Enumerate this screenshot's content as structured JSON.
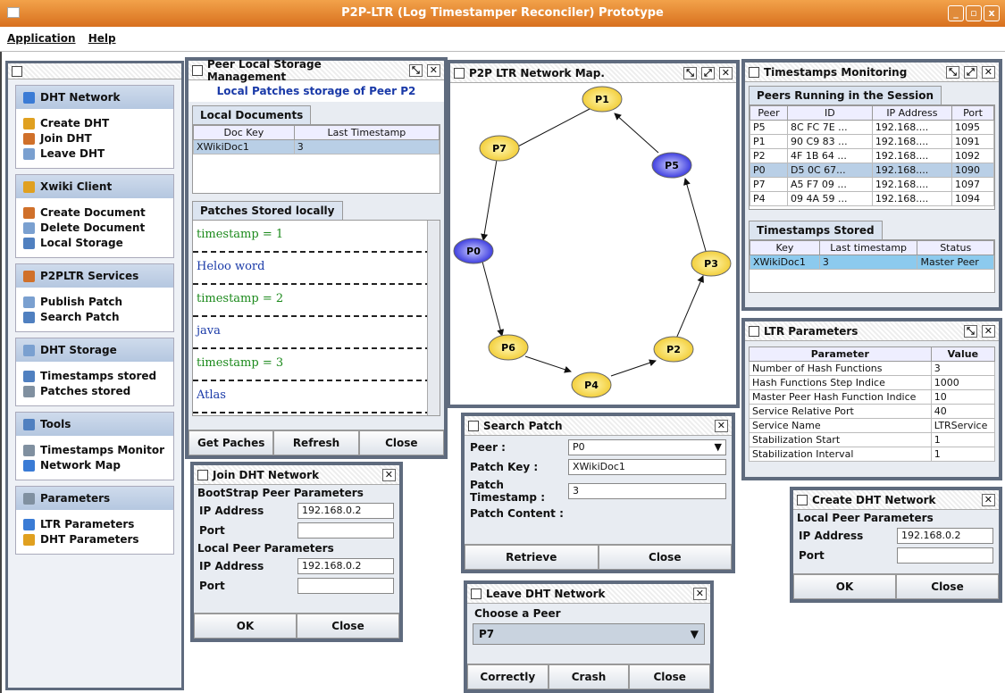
{
  "window": {
    "title": "P2P-LTR (Log Timestamper Reconciler) Prototype"
  },
  "menu": [
    "Application",
    "Help"
  ],
  "sidebar": {
    "sections": [
      {
        "title": "DHT Network",
        "items": [
          "Create DHT",
          "Join DHT",
          "Leave DHT"
        ]
      },
      {
        "title": "Xwiki Client",
        "items": [
          "Create Document",
          "Delete Document",
          "Local Storage"
        ]
      },
      {
        "title": "P2PLTR Services",
        "items": [
          "Publish Patch",
          "Search Patch"
        ]
      },
      {
        "title": "DHT Storage",
        "items": [
          "Timestamps stored",
          "Patches stored"
        ]
      },
      {
        "title": "Tools",
        "items": [
          "Timestamps Monitor",
          "Network Map"
        ]
      },
      {
        "title": "Parameters",
        "items": [
          "LTR Parameters",
          "DHT Parameters"
        ]
      }
    ]
  },
  "storage": {
    "title": "Peer Local Storage Management",
    "subtitle": "Local Patches storage of Peer P2",
    "tab1": "Local Documents",
    "cols": [
      "Doc Key",
      "Last Timestamp"
    ],
    "rows": [
      [
        "XWikiDoc1",
        "3"
      ]
    ],
    "tab2": "Patches Stored locally",
    "patches": [
      "timestamp = 1",
      "Heloo word",
      "timestamp = 2",
      "java",
      "timestamp = 3",
      "Atlas"
    ],
    "buttons": [
      "Get Paches",
      "Refresh",
      "Close"
    ]
  },
  "map": {
    "title": "P2P LTR Network Map.",
    "nodes": [
      "P1",
      "P5",
      "P3",
      "P2",
      "P4",
      "P6",
      "P0",
      "P7"
    ]
  },
  "monitor": {
    "title": "Timestamps Monitoring",
    "tab1": "Peers Running in the Session",
    "cols": [
      "Peer",
      "ID",
      "IP Address",
      "Port"
    ],
    "rows": [
      [
        "P5",
        "8C FC 7E ...",
        "192.168....",
        "1095"
      ],
      [
        "P1",
        "90 C9 83 ...",
        "192.168....",
        "1091"
      ],
      [
        "P2",
        "4F 1B 64 ...",
        "192.168....",
        "1092"
      ],
      [
        "P0",
        "D5 0C 67...",
        "192.168....",
        "1090"
      ],
      [
        "P7",
        "A5 F7 09 ...",
        "192.168....",
        "1097"
      ],
      [
        "P4",
        "09 4A 59 ...",
        "192.168....",
        "1094"
      ]
    ],
    "tab2": "Timestamps Stored",
    "cols2": [
      "Key",
      "Last timestamp",
      "Status"
    ],
    "rows2": [
      [
        "XWikiDoc1",
        "3",
        "Master Peer"
      ]
    ]
  },
  "ltr": {
    "title": "LTR Parameters",
    "cols": [
      "Parameter",
      "Value"
    ],
    "rows": [
      [
        "Number of Hash Functions",
        "3"
      ],
      [
        "Hash Functions Step Indice",
        "1000"
      ],
      [
        "Master Peer Hash Function Indice",
        "10"
      ],
      [
        "Service Relative Port",
        "40"
      ],
      [
        "Service Name",
        "LTRService"
      ],
      [
        "Stabilization Start",
        "1"
      ],
      [
        "Stabilization Interval",
        "1"
      ]
    ]
  },
  "search": {
    "title": "Search Patch",
    "peer_label": "Peer :",
    "peer": "P0",
    "key_label": "Patch Key :",
    "key": "XWikiDoc1",
    "ts_label": "Patch Timestamp :",
    "ts": "3",
    "content_label": "Patch Content :",
    "buttons": [
      "Retrieve",
      "Close"
    ]
  },
  "join": {
    "title": "Join DHT Network",
    "group1": "BootStrap Peer Parameters",
    "ip_label": "IP Address",
    "ip1": "192.168.0.2",
    "port_label": "Port",
    "group2": "Local Peer Parameters",
    "ip2": "192.168.0.2",
    "buttons": [
      "OK",
      "Close"
    ]
  },
  "leave": {
    "title": "Leave DHT Network",
    "choose": "Choose a Peer",
    "peer": "P7",
    "buttons": [
      "Correctly",
      "Crash",
      "Close"
    ]
  },
  "create": {
    "title": "Create DHT Network",
    "group": "Local Peer Parameters",
    "ip_label": "IP Address",
    "ip": "192.168.0.2",
    "port_label": "Port",
    "buttons": [
      "OK",
      "Close"
    ]
  }
}
